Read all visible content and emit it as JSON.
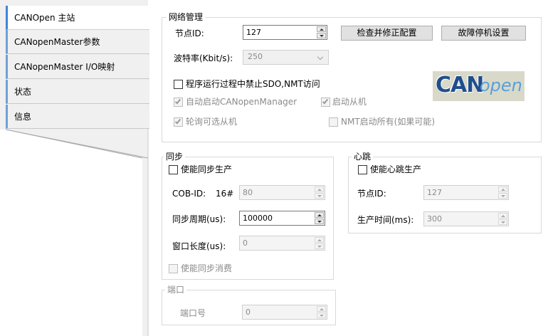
{
  "tabs": [
    {
      "label": "CANOpen 主站",
      "active": true
    },
    {
      "label": "CANopenMaster参数",
      "active": false
    },
    {
      "label": "CANopenMaster I/O映射",
      "active": false
    },
    {
      "label": "状态",
      "active": false
    },
    {
      "label": "信息",
      "active": false
    }
  ],
  "network": {
    "title": "网络管理",
    "node_id_label": "节点ID:",
    "node_id_value": "127",
    "check_fix_button": "检查并修正配置",
    "fault_stop_button": "故障停机设置",
    "baud_label": "波特率(Kbit/s):",
    "baud_value": "250",
    "disable_sdo_label": "程序运行过程中禁止SDO,NMT访问",
    "auto_start_label": "自动启动CANopenManager",
    "start_slave_label": "启动从机",
    "poll_optional_label": "轮询可选从机",
    "nmt_start_all_label": "NMT启动所有(如果可能)",
    "logo_can": "CAN",
    "logo_open": "open"
  },
  "sync": {
    "title": "同步",
    "enable_produce_label": "使能同步生产",
    "cob_id_label": "COB-ID:",
    "cob_id_prefix": "16#",
    "cob_id_value": "80",
    "period_label": "同步周期(us):",
    "period_value": "100000",
    "window_label": "窗口长度(us):",
    "window_value": "0",
    "enable_consume_label": "使能同步消费"
  },
  "heartbeat": {
    "title": "心跳",
    "enable_produce_label": "使能心跳生产",
    "node_id_label": "节点ID:",
    "node_id_value": "127",
    "produce_time_label": "生产时间(ms):",
    "produce_time_value": "300"
  },
  "port": {
    "title": "端口",
    "port_no_label": "端口号",
    "port_no_value": "0"
  }
}
